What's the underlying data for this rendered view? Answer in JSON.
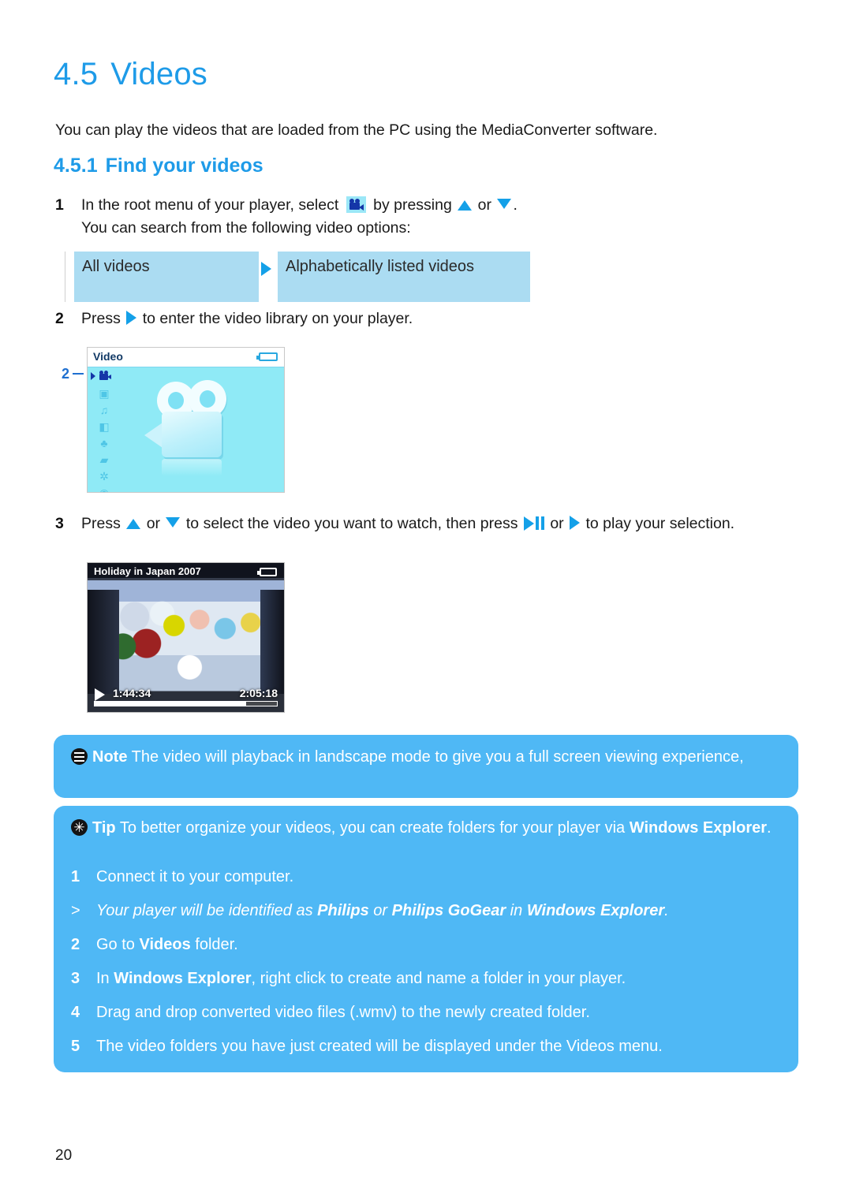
{
  "document": {
    "page_number": "20"
  },
  "heading": {
    "section_number": "4.5",
    "section_title": "Videos",
    "intro": "You can play the videos that are loaded from the PC using the MediaConverter software.",
    "sub_number": "4.5.1",
    "sub_title": "Find your videos"
  },
  "steps": {
    "one": {
      "marker": "1",
      "text_before_icon": "In the root menu of your player, select",
      "text_after_icon": "by pressing",
      "or_label": "or",
      "period": ".",
      "line2": "You can search from the following video options:"
    },
    "two": {
      "marker": "2",
      "text_before_icon": "Press",
      "text_after_icon": "to enter the video library on your player."
    },
    "three": {
      "marker": "3",
      "part1": "Press",
      "or_label": "or",
      "part2": "to select the video you want to watch, then press",
      "or_label2": "or",
      "part3": "to play your selection."
    }
  },
  "options_table": {
    "cell_left": "All videos",
    "cell_right": "Alphabetically listed videos"
  },
  "device_menu": {
    "title": "Video",
    "battery_icon": "battery-icon",
    "selected_icon": "video-camera-icon",
    "rail_icons": [
      "video-camera-icon",
      "camera-icon",
      "music-note-icon",
      "radio-icon",
      "microphone-icon",
      "folder-icon",
      "gear-icon",
      "play-circle-icon"
    ],
    "main_graphic": "camcorder-icon",
    "callout_marker": "2"
  },
  "device_playback": {
    "video_title": "Holiday in Japan 2007",
    "battery_icon": "battery-icon",
    "play_icon": "play-icon",
    "time_elapsed": "1:44:34",
    "time_total": "2:05:18",
    "progress_percent": 83
  },
  "note_box": {
    "icon": "note-icon",
    "label": "Note",
    "text": "The video will playback in landscape mode to give you a full screen viewing experience,"
  },
  "tip_box": {
    "icon": "tip-icon",
    "label": "Tip",
    "lead_text": "To better organize your videos, you can create folders for your player via",
    "lead_bold": "Windows Explorer",
    "lead_end": ".",
    "steps": [
      {
        "marker": "1",
        "style": "normal",
        "html": "Connect it to your computer."
      },
      {
        "marker": ">",
        "style": "italic",
        "html": "Your player will be identified as <b>Philips</b> or <b>Philips GoGear</b> in <b>Windows Explorer</b>."
      },
      {
        "marker": "2",
        "style": "normal",
        "html": "Go to <b>Videos</b> folder."
      },
      {
        "marker": "3",
        "style": "normal",
        "html": "In <b>Windows Explorer</b>, right click to create and name a folder in your player."
      },
      {
        "marker": "4",
        "style": "normal",
        "html": "Drag and drop converted video files (.wmv) to the newly created folder."
      },
      {
        "marker": "5",
        "style": "normal",
        "html": "The video folders you have just created will be displayed under the Videos menu."
      }
    ]
  },
  "colors": {
    "heading_blue": "#1E9BE8",
    "callout_blue": "#4FB8F5",
    "table_cell_blue": "#ABDCF2",
    "glyph_blue": "#14A0E8",
    "device_screen_cyan": "#8FEAF6",
    "device_icon_navy": "#1436A8"
  }
}
